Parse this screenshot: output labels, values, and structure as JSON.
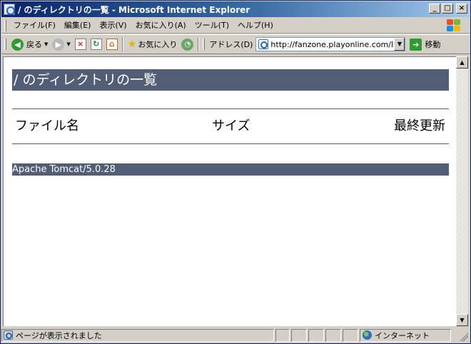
{
  "window": {
    "title": "/ のディレクトリの一覧 - Microsoft Internet Explorer"
  },
  "menu": {
    "items": [
      "ファイル(F)",
      "編集(E)",
      "表示(V)",
      "お気に入り(A)",
      "ツール(T)",
      "ヘルプ(H)"
    ]
  },
  "toolbar": {
    "back_label": "戻る",
    "favorites_label": "お気に入り",
    "address_label": "アドレス(D)",
    "address_value": "http://fanzone.playonline.com/lsco",
    "go_label": "移動"
  },
  "page": {
    "heading": "/ のディレクトリの一覧",
    "columns": {
      "filename": "ファイル名",
      "size": "サイズ",
      "modified": "最終更新"
    },
    "footer": "Apache Tomcat/5.0.28"
  },
  "status": {
    "message": "ページが表示されました",
    "zone": "インターネット"
  },
  "colors": {
    "heading_bg": "#525d76",
    "titlebar_start": "#0a246a",
    "titlebar_end": "#a6caf0"
  }
}
